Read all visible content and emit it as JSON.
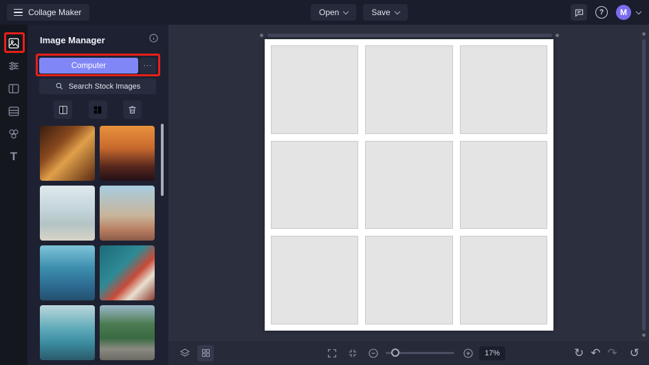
{
  "topbar": {
    "app_title": "Collage Maker",
    "open_label": "Open",
    "save_label": "Save",
    "help_label": "?",
    "avatar_initial": "M"
  },
  "panel": {
    "title": "Image Manager",
    "computer_label": "Computer",
    "more_label": "···",
    "search_label": "Search Stock Images"
  },
  "statusbar": {
    "zoom_level": "17%"
  },
  "icons": {
    "undo": "↶",
    "redo": "↷",
    "refresh": "↻",
    "history": "↺"
  },
  "colors": {
    "accent": "#8186f7",
    "annotation_red": "#e82017",
    "canvas_cell": "#e4e4e4",
    "topbar_bg": "#1a1d2b",
    "panel_bg": "#1e2132"
  },
  "canvas": {
    "rows": 3,
    "cols": 3
  },
  "thumbnails": [
    {
      "name": "cheers-toast",
      "css": "background:linear-gradient(135deg,#3a1d10 0%,#8a4a1e 35%,#e0a04a 55%,#5a2a12 100%)"
    },
    {
      "name": "couple-sunset",
      "css": "background:linear-gradient(180deg,#e8913c 0%,#c96a2e 40%,#55261c 75%,#241017 100%)"
    },
    {
      "name": "lake-beach",
      "css": "background:linear-gradient(180deg,#dfe9ec 0%,#c2d4da 45%,#b4c4c4 70%,#d8d4c8 100%)"
    },
    {
      "name": "beach-van-friends",
      "css": "background:linear-gradient(180deg,#a8cde0 0%,#c8b49a 55%,#b87f62 80%,#8a5a48 100%)"
    },
    {
      "name": "blue-van-woman",
      "css": "background:linear-gradient(180deg,#7ec3d8 0%,#3e8fb0 40%,#2e6f96 70%,#24506e 100%)"
    },
    {
      "name": "woman-reading",
      "css": "background:linear-gradient(135deg,#1e6a78 0%,#2e8a96 40%,#c84a38 60%,#e8e0d0 75%,#8a3a2e 100%)"
    },
    {
      "name": "teal-car-man",
      "css": "background:linear-gradient(180deg,#bcd8dc 0%,#5aa8b8 45%,#3a8a9e 70%,#2a5a6a 100%)"
    },
    {
      "name": "road-hills",
      "css": "background:linear-gradient(180deg,#9ab8c8 0%,#4a7a50 35%,#3a6a42 60%,#8a8a82 80%,#6a6a64 100%)"
    }
  ]
}
